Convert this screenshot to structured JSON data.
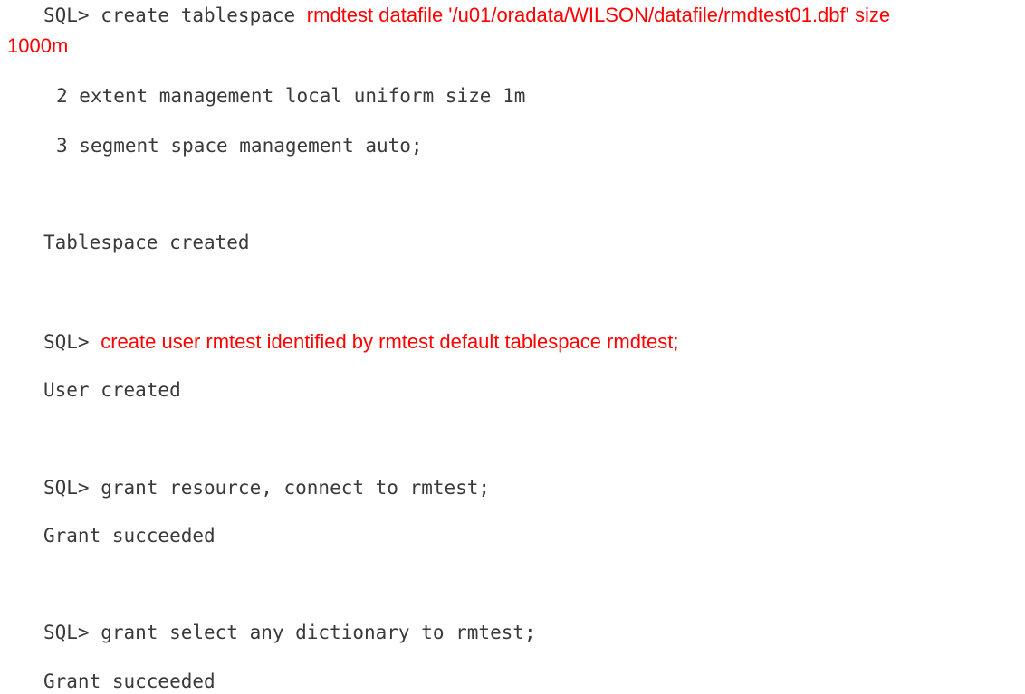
{
  "colors": {
    "text": "#3a3a3a",
    "highlight": "#ff0000",
    "background": "#ffffff"
  },
  "lines": {
    "l1_prompt": "SQL> create tablespace ",
    "l1_red": "rmdtest datafile '/u01/oradata/WILSON/datafile/rmdtest01.dbf' size",
    "l1_wrap": "1000m",
    "l2": "2 extent management local uniform size 1m",
    "l3": "3 segment space management auto;",
    "l4": "Tablespace created",
    "l5_prompt": "SQL> ",
    "l5_red": "create user rmtest identified by rmtest default tablespace rmdtest;",
    "l6": "User created",
    "l7": "SQL> grant resource, connect to rmtest;",
    "l8": "Grant succeeded",
    "l9": "SQL> grant select any dictionary to rmtest;",
    "l10": "Grant succeeded"
  }
}
